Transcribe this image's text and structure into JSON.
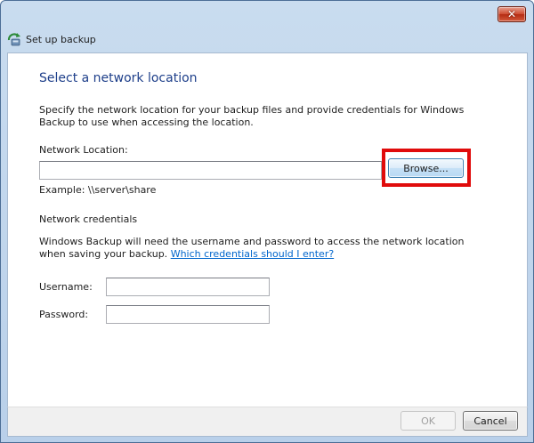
{
  "window": {
    "title": "Set up backup",
    "close_symbol": "✕"
  },
  "page": {
    "heading": "Select a network location",
    "description": "Specify the network location for your backup files and provide credentials for Windows Backup to use when accessing the location."
  },
  "location": {
    "label": "Network Location:",
    "value": "",
    "browse_label": "Browse...",
    "example": "Example: \\\\server\\share"
  },
  "credentials": {
    "section_title": "Network credentials",
    "description": "Windows Backup will need the username and password to access the network location when saving your backup.",
    "link_text": "Which credentials should I enter?",
    "username_label": "Username:",
    "username_value": "",
    "password_label": "Password:",
    "password_value": ""
  },
  "footer": {
    "ok_label": "OK",
    "cancel_label": "Cancel"
  },
  "colors": {
    "heading": "#1e3f8a",
    "link": "#0066cc",
    "highlight": "#e00b0b"
  }
}
